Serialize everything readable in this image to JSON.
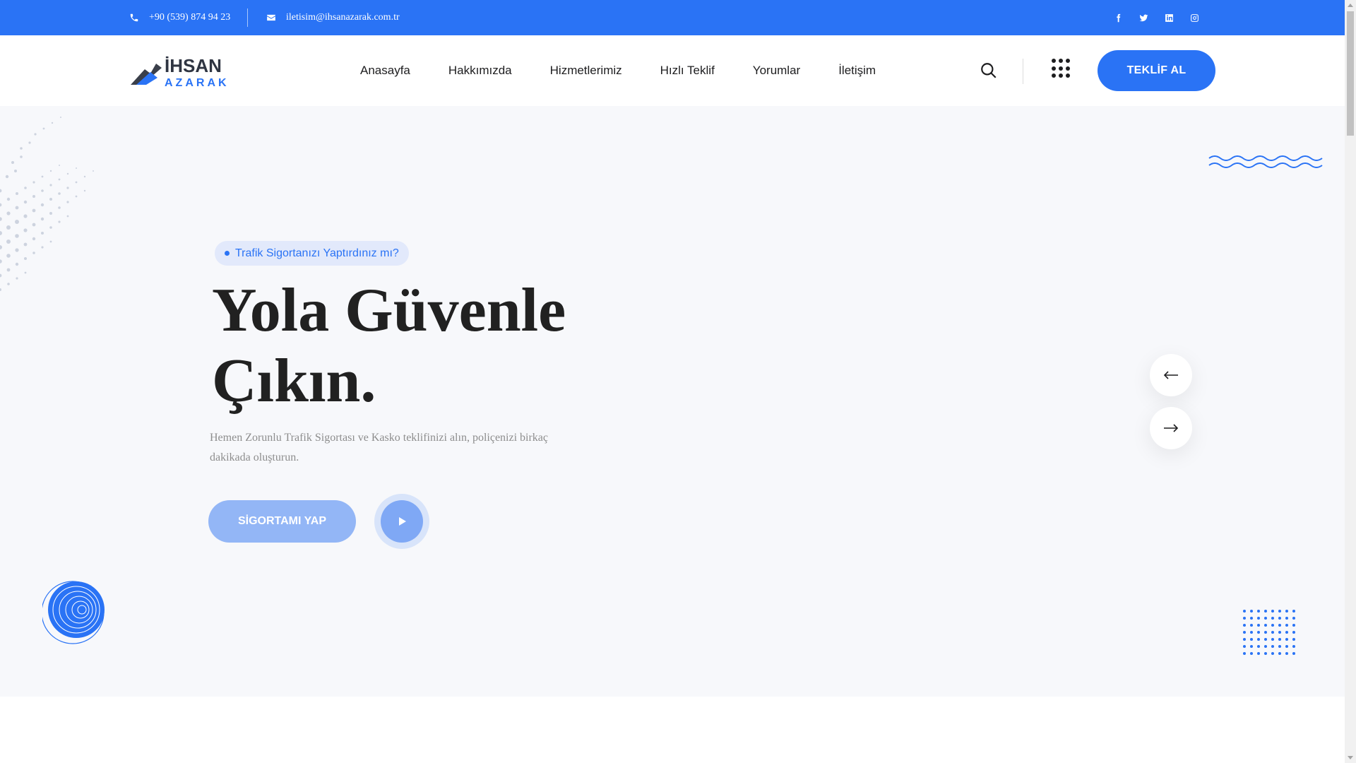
{
  "topbar": {
    "phone": "+90 (539) 874 94 23",
    "email": "iletisim@ihsanazarak.com.tr",
    "social": [
      "facebook-icon",
      "twitter-icon",
      "linkedin-icon",
      "instagram-icon"
    ]
  },
  "header": {
    "logo_text": "İHSAN",
    "logo_subtext": "AZARAK",
    "nav": [
      "Anasayfa",
      "Hakkımızda",
      "Hizmetlerimiz",
      "Hızlı Teklif",
      "Yorumlar",
      "İletişim"
    ],
    "cta_label": "TEKLİF AL"
  },
  "hero": {
    "badge": "Trafik Sigortanızı Yaptırdınız mı?",
    "headline_line1": "Yola Güvenle",
    "headline_line2": "Çıkın.",
    "subtitle": "Hemen Zorunlu Trafik Sigortası ve Kasko teklifinizi alın, poliçenizi birkaç dakikada oluşturun.",
    "button_label": "SİGORTAMI YAP"
  },
  "colors": {
    "brand": "#2a73f5",
    "text_dark": "#212121",
    "muted": "#8d8d8d"
  }
}
